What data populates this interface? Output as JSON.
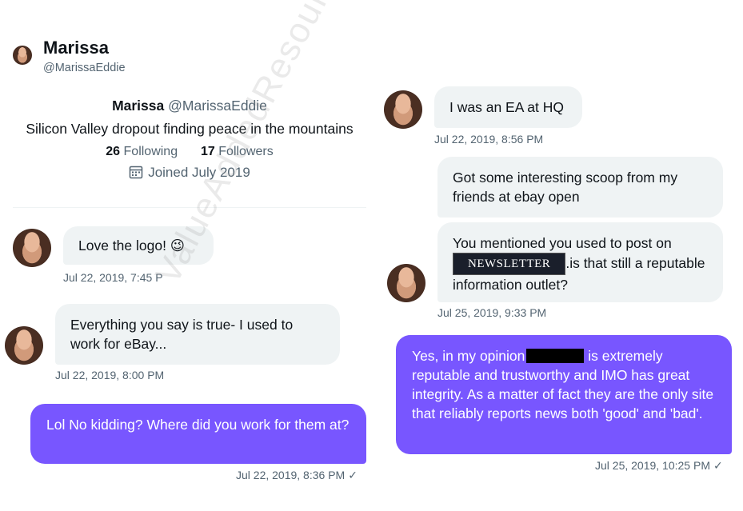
{
  "header": {
    "name": "Marissa",
    "handle": "@MarissaEddie"
  },
  "profile": {
    "name": "Marissa",
    "handle": "@MarissaEddie",
    "bio": "Silicon Valley dropout finding peace in the mountains",
    "following_count": "26",
    "following_label": "Following",
    "followers_count": "17",
    "followers_label": "Followers",
    "joined": "Joined July 2019"
  },
  "left_messages": [
    {
      "text": "Love the logo! 😉",
      "time": "Jul 22, 2019, 7:45 P"
    },
    {
      "text": "Everything you say is true- I used to work for eBay...",
      "time": "Jul 22, 2019, 8:00 PM"
    },
    {
      "text": "Lol No kidding? Where did you work for them at?",
      "time": "Jul 22, 2019, 8:36 PM"
    }
  ],
  "right_messages": [
    {
      "text": "I was an EA at HQ",
      "time": "Jul 22, 2019, 8:56 PM"
    },
    {
      "text": "Got some interesting scoop from my friends at ebay open"
    },
    {
      "text_before": "You mentioned you used to post on",
      "redacted_label": "NEWSLETTER",
      "text_after": ".is that still a reputable information outlet?",
      "time": "Jul 25, 2019, 9:33 PM"
    },
    {
      "text_before": "Yes, in my opinion",
      "text_after": " is extremely reputable and trustworthy and IMO has great integrity. As a matter of fact they are the only site that reliably reports news both 'good' and 'bad'.",
      "time": "Jul 25, 2019, 10:25 PM"
    }
  ],
  "watermark": "ValueAddedResource.net",
  "icons": {
    "check": "✓"
  },
  "colors": {
    "sent_bubble": "#7856ff",
    "received_bubble": "#eff3f4",
    "muted_text": "#536471"
  }
}
